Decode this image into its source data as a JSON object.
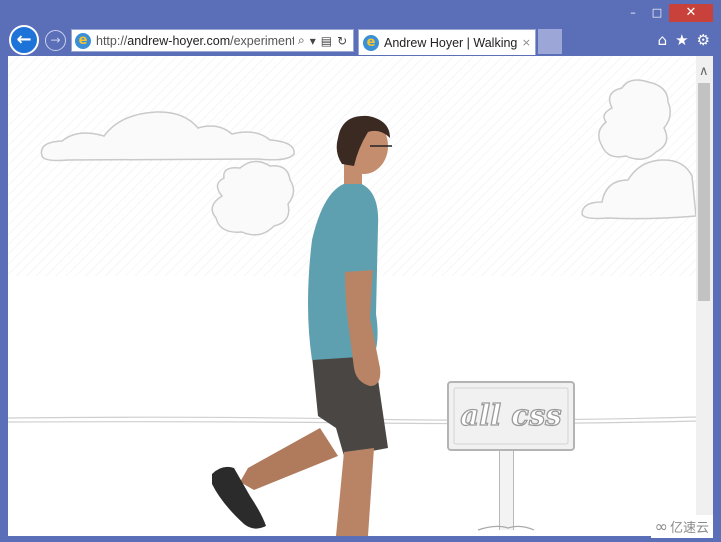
{
  "browser": {
    "address_url_base": "http://",
    "address_url_domain": "andrew-hoyer.com",
    "address_url_path": "/experiments",
    "tab_title": "Andrew Hoyer | Walking ...",
    "tab_close": "×",
    "back_icon": "←",
    "forward_icon": "→",
    "search_icon": "⌕",
    "dropdown_icon": "▾",
    "refresh_icon": "↻",
    "compat_icon": "▤",
    "home_icon": "⌂",
    "favorites_icon": "★",
    "settings_icon": "⚙",
    "minimize": "–",
    "maximize": "□",
    "close": "✕"
  },
  "page": {
    "sign_text": "all css"
  },
  "watermark": {
    "text": "亿速云",
    "logo": "∞"
  },
  "colors": {
    "frame": "#5b6fb8",
    "close_button": "#c8413a",
    "back_button": "#1e73d8"
  }
}
